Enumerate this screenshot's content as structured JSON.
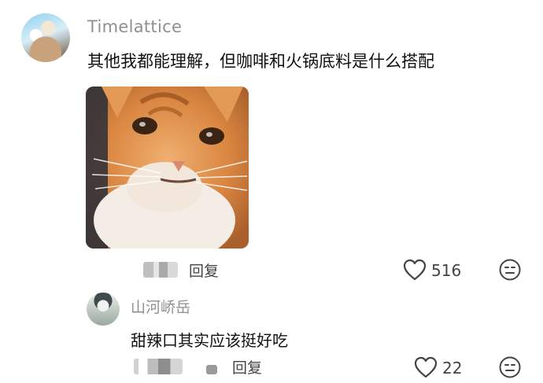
{
  "comment": {
    "username": "Timelattice",
    "text": "其他我都能理解，但咖啡和火锅底料是什么搭配",
    "reply_label": "回复",
    "like_count": "516"
  },
  "reply": {
    "username": "山河峤岳",
    "text": "甜辣口其实应该挺好吃",
    "reply_label": "回复",
    "like_count": "22"
  },
  "icons": {
    "like": "heart-outline-icon",
    "dislike": "neutral-face-icon"
  },
  "colors": {
    "username": "#8f8f8f",
    "text": "#111111",
    "meta": "#444444"
  }
}
